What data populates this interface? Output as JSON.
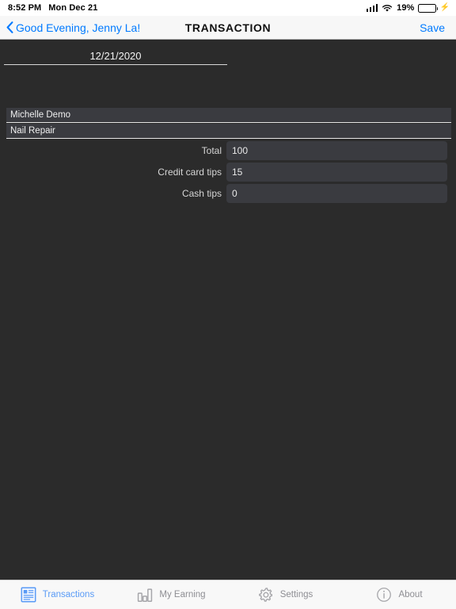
{
  "status_bar": {
    "time": "8:52 PM",
    "date": "Mon Dec 21",
    "battery_percent": "19%",
    "icons": {
      "signal": "cellular-signal-icon",
      "wifi": "wifi-icon",
      "battery": "battery-icon",
      "charging": "charging-bolt-icon"
    },
    "colors": {
      "battery_fill": "#4cd964"
    }
  },
  "nav_bar": {
    "back_label": "Good Evening, Jenny La!",
    "title": "TRANSACTION",
    "save_label": "Save",
    "accent_color": "#007aff"
  },
  "form": {
    "date_value": "12/21/2020",
    "client_value": "Michelle Demo",
    "service_value": "Nail Repair",
    "fields": [
      {
        "label": "Total",
        "value": "100"
      },
      {
        "label": "Credit card tips",
        "value": "15"
      },
      {
        "label": "Cash tips",
        "value": "0"
      }
    ]
  },
  "tab_bar": {
    "active_color": "#5a9bf6",
    "inactive_color": "#8e8e93",
    "tabs": [
      {
        "label": "Transactions",
        "icon": "document-list-icon",
        "active": true
      },
      {
        "label": "My Earning",
        "icon": "bar-chart-icon",
        "active": false
      },
      {
        "label": "Settings",
        "icon": "gear-icon",
        "active": false
      },
      {
        "label": "About",
        "icon": "info-circle-icon",
        "active": false
      }
    ]
  }
}
